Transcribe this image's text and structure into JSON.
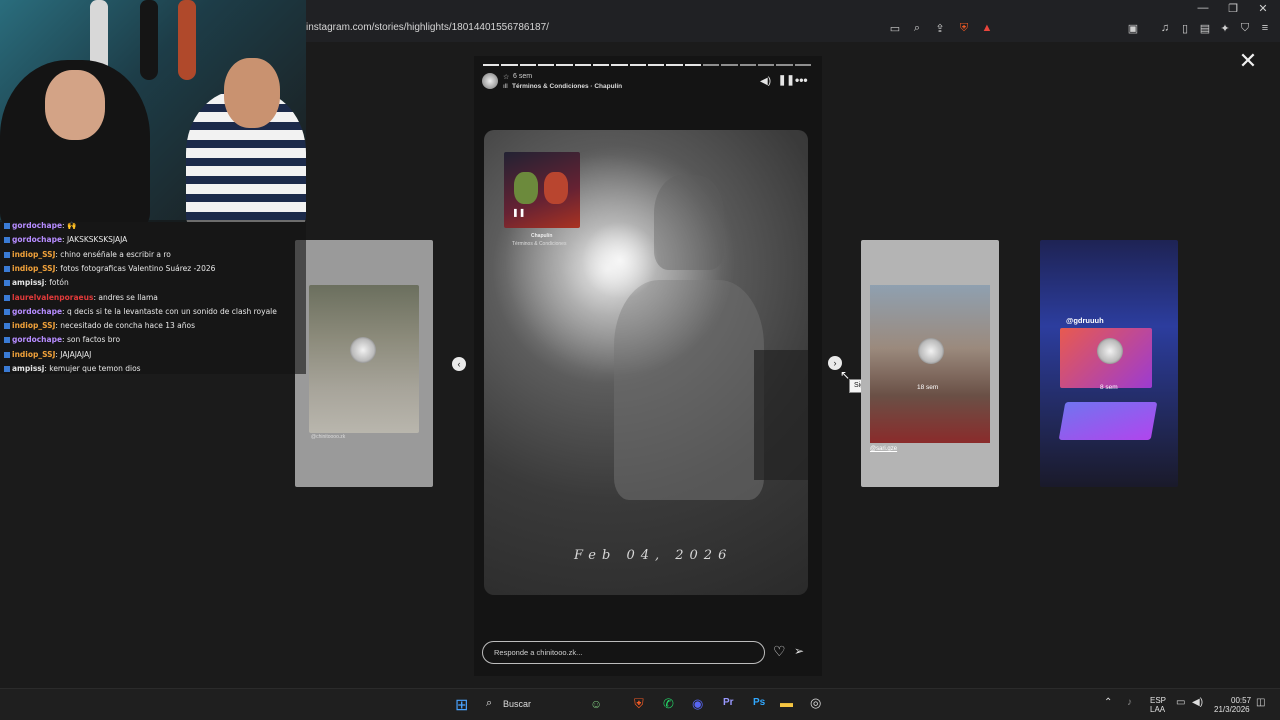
{
  "browser": {
    "url": "instagram.com/stories/highlights/18014401556786187/"
  },
  "chat": [
    {
      "user": "gordochape",
      "user_color": "#b68cff",
      "msg": ": 🙌"
    },
    {
      "user": "gordochape",
      "user_color": "#b68cff",
      "msg": ": JAKSKSKSKSJAJA"
    },
    {
      "user": "indiop_SSJ",
      "user_color": "#f2a23a",
      "msg": ": chino enséñale a escribir a ro"
    },
    {
      "user": "indiop_SSJ",
      "user_color": "#f2a23a",
      "msg": ": fotos fotograficas Valentino Suárez -2026"
    },
    {
      "user": "ampissj",
      "user_color": "#e6e6e6",
      "msg": ": fotón"
    },
    {
      "user": "laurelvalenporaeus",
      "user_color": "#e23a3a",
      "msg": ": andres se llama"
    },
    {
      "user": "gordochape",
      "user_color": "#b68cff",
      "msg": ": q decis si te la levantaste con un sonido de clash royale"
    },
    {
      "user": "indiop_SSJ",
      "user_color": "#f2a23a",
      "msg": ": necesitado de concha hace 13 años"
    },
    {
      "user": "gordochape",
      "user_color": "#b68cff",
      "msg": ": son factos bro"
    },
    {
      "user": "indiop_SSJ",
      "user_color": "#f2a23a",
      "msg": ": JAJAJAJAJ"
    },
    {
      "user": "ampissj",
      "user_color": "#e6e6e6",
      "msg": ": kemujer que temon dios"
    }
  ],
  "story": {
    "time_ago": "6 sem",
    "music_line": "Términos & Condiciones · Chapulín",
    "sticker_artist": "Chapulín",
    "sticker_song": "Términos & Condiciones",
    "date_overlay": "Feb 04, 2026",
    "reply_placeholder": "Responde a chinitooo.zk..."
  },
  "side_stories": {
    "right1_time": "18 sem",
    "right1_handle": "@sari.gze",
    "right2_time": "8 sem",
    "right2_handle": "@gdruuuh",
    "left1_handle": "@chinitoooo.zk"
  },
  "tooltip": "Siguiente",
  "taskbar": {
    "search": "Buscar",
    "lang1": "ESP",
    "lang2": "LAA",
    "time": "00:57",
    "date": "21/3/2026"
  }
}
